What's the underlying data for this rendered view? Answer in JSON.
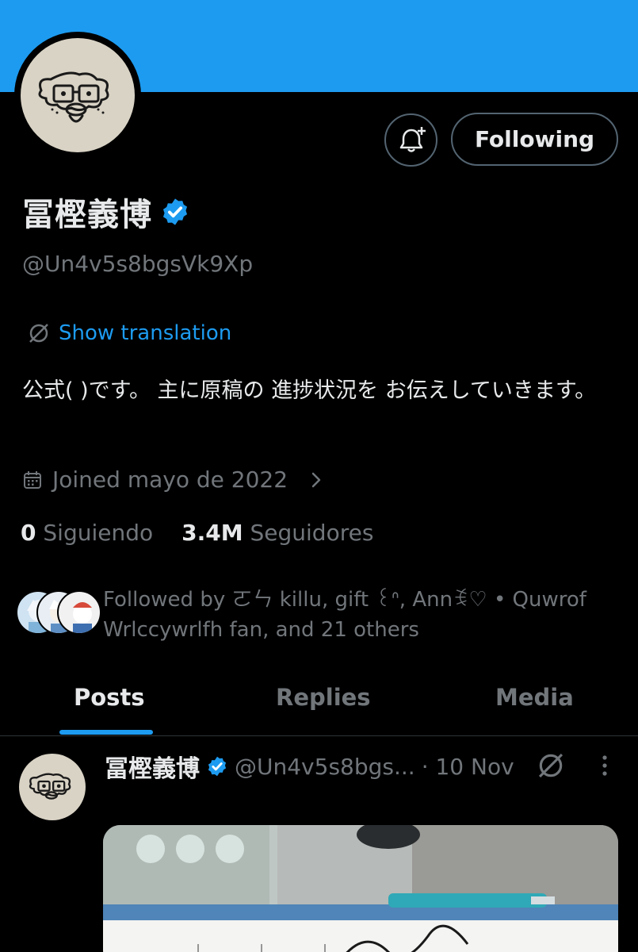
{
  "profile": {
    "display_name": "冨樫義博",
    "handle": "@Un4v5s8bgsVk9Xp",
    "follow_button_label": "Following",
    "translate_label": "Show translation",
    "bio": "公式( )です。 主に原稿の 進捗状況を お伝えしていきます。",
    "joined": "Joined mayo de 2022",
    "following_count": "0",
    "following_label": "Siguiendo",
    "followers_count": "3.4M",
    "followers_label": "Seguidores",
    "followed_by": "Followed by ㄛㄣ killu, gift ꒰ᐢ, Annꉂ♡ • Quwrof Wrlccywrlfh fan, and 21 others"
  },
  "tabs": [
    {
      "label": "Posts",
      "active": true
    },
    {
      "label": "Replies",
      "active": false
    },
    {
      "label": "Media",
      "active": false
    }
  ],
  "post": {
    "author_name": "冨樫義博",
    "author_handle": "@Un4v5s8bgs...",
    "date": "· 10 Nov"
  },
  "icons": {
    "bell": "bell-plus-icon",
    "verified": "verified-badge-icon",
    "translate": "grok-translate-icon",
    "calendar": "calendar-icon",
    "chevron": "chevron-right-icon",
    "more": "more-vertical-icon"
  },
  "colors": {
    "accent": "#1d9bf0",
    "background": "#000000",
    "text_primary": "#e7e9ea",
    "text_secondary": "#71767b",
    "border": "#536471"
  }
}
